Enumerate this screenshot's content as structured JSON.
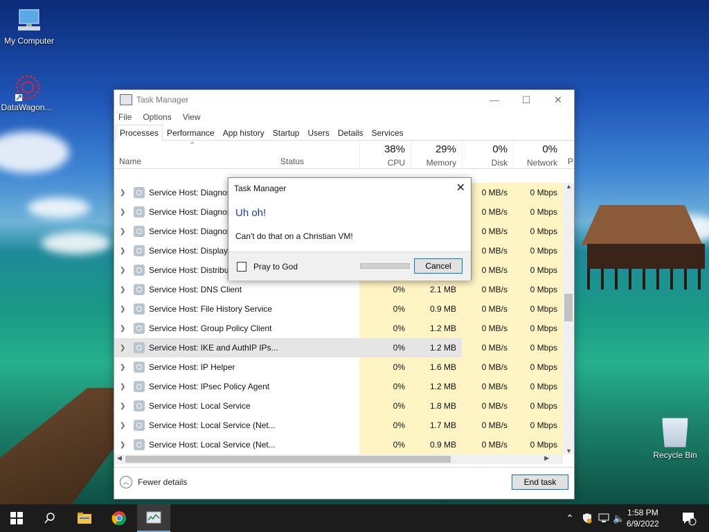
{
  "desktop": {
    "icons": [
      {
        "label": "My Computer"
      },
      {
        "label": "DataWagon..."
      }
    ],
    "recycle_bin": "Recycle Bin"
  },
  "task_manager": {
    "title": "Task Manager",
    "menu": [
      "File",
      "Options",
      "View"
    ],
    "tabs": [
      "Processes",
      "Performance",
      "App history",
      "Startup",
      "Users",
      "Details",
      "Services"
    ],
    "active_tab": "Processes",
    "columns": {
      "name": "Name",
      "status": "Status",
      "cpu": {
        "pct": "38%",
        "label": "CPU"
      },
      "memory": {
        "pct": "29%",
        "label": "Memory"
      },
      "disk": {
        "pct": "0%",
        "label": "Disk"
      },
      "network": {
        "pct": "0%",
        "label": "Network"
      },
      "extra": "P"
    },
    "rows": [
      {
        "name": "Service Host: Diagnos",
        "cpu": "",
        "mem": "",
        "disk": "0 MB/s",
        "net": "0 Mbps"
      },
      {
        "name": "Service Host: Diagnos",
        "cpu": "",
        "mem": "",
        "disk": "0 MB/s",
        "net": "0 Mbps"
      },
      {
        "name": "Service Host: Diagnos",
        "cpu": "",
        "mem": "",
        "disk": "0 MB/s",
        "net": "0 Mbps"
      },
      {
        "name": "Service Host: Display",
        "cpu": "",
        "mem": "",
        "disk": "0 MB/s",
        "net": "0 Mbps"
      },
      {
        "name": "Service Host: Distribut",
        "cpu": "",
        "mem": "",
        "disk": "0 MB/s",
        "net": "0 Mbps"
      },
      {
        "name": "Service Host: DNS Client",
        "cpu": "0%",
        "mem": "2.1 MB",
        "disk": "0 MB/s",
        "net": "0 Mbps"
      },
      {
        "name": "Service Host: File History Service",
        "cpu": "0%",
        "mem": "0.9 MB",
        "disk": "0 MB/s",
        "net": "0 Mbps"
      },
      {
        "name": "Service Host: Group Policy Client",
        "cpu": "0%",
        "mem": "1.2 MB",
        "disk": "0 MB/s",
        "net": "0 Mbps"
      },
      {
        "name": "Service Host: IKE and AuthIP IPs...",
        "cpu": "0%",
        "mem": "1.2 MB",
        "disk": "0 MB/s",
        "net": "0 Mbps",
        "selected": true
      },
      {
        "name": "Service Host: IP Helper",
        "cpu": "0%",
        "mem": "1.6 MB",
        "disk": "0 MB/s",
        "net": "0 Mbps"
      },
      {
        "name": "Service Host: IPsec Policy Agent",
        "cpu": "0%",
        "mem": "1.2 MB",
        "disk": "0 MB/s",
        "net": "0 Mbps"
      },
      {
        "name": "Service Host: Local Service",
        "cpu": "0%",
        "mem": "1.8 MB",
        "disk": "0 MB/s",
        "net": "0 Mbps"
      },
      {
        "name": "Service Host: Local Service (Net...",
        "cpu": "0%",
        "mem": "1.7 MB",
        "disk": "0 MB/s",
        "net": "0 Mbps"
      },
      {
        "name": "Service Host: Local Service (Net...",
        "cpu": "0%",
        "mem": "0.9 MB",
        "disk": "0 MB/s",
        "net": "0 Mbps"
      }
    ],
    "fewer_details": "Fewer details",
    "end_task": "End task"
  },
  "dialog": {
    "title": "Task Manager",
    "heading": "Uh oh!",
    "message": "Can't do that on a Christian VM!",
    "checkbox_label": "Pray to God",
    "cancel": "Cancel"
  },
  "taskbar": {
    "time": "1:58 PM",
    "date": "6/9/2022",
    "notification_count": "1"
  }
}
